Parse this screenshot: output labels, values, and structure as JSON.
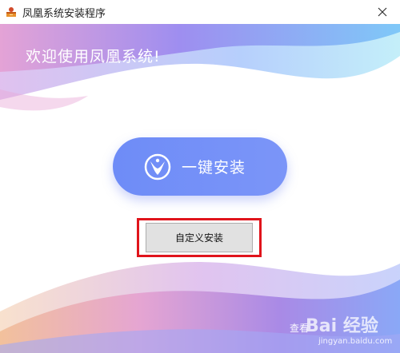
{
  "window": {
    "title": "凤凰系统安装程序",
    "icon": "app-installer-icon",
    "close_icon": "close-icon"
  },
  "main": {
    "welcome": "欢迎使用凤凰系统!",
    "primary_button": {
      "label": "一键安装",
      "icon": "phoenix-logo-icon"
    },
    "secondary_button": {
      "label": "自定义安装"
    },
    "bottom_link": "查看",
    "watermark": "Bai 经验",
    "watermark_sub": "jingyan.baidu.com"
  },
  "colors": {
    "accent": "#7b95f8",
    "highlight": "#e0141b",
    "button_bg": "#e1e1e1",
    "wave_pink": "#e8a8d8",
    "wave_blue": "#7fb3ff",
    "wave_purple": "#a07de0"
  }
}
